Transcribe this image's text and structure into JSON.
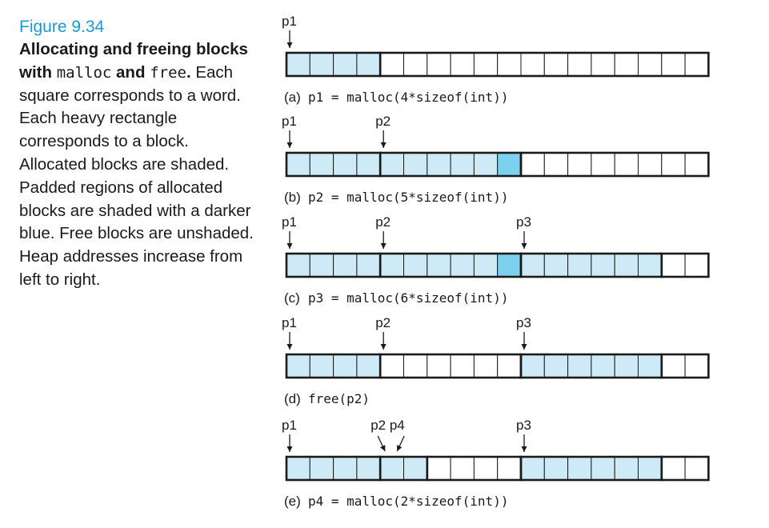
{
  "caption": {
    "figure_label": "Figure 9.34",
    "title_part1": "Allocating and freeing blocks with ",
    "title_code1": "malloc",
    "title_part2": "and ",
    "title_code2": "free",
    "title_part3": ".",
    "body": " Each square corresponds to a word. Each heavy rectangle corresponds to a block. Allocated blocks are shaded. Padded regions of allocated blocks are shaded with a darker blue. Free blocks are unshaded. Heap addresses increase from left to right."
  },
  "colors": {
    "allocated": "#cfeaf7",
    "padding": "#7ed0ef",
    "free": "#ffffff",
    "outline": "#1a1a1a",
    "figure_label": "#1c9ad6"
  },
  "word_count": 18,
  "rows": [
    {
      "label": "(a)",
      "code": "p1 = malloc(4*sizeof(int))",
      "pointers": [
        {
          "name": "p1",
          "word": 0
        }
      ],
      "blocks": [
        {
          "start": 0,
          "size": 4,
          "state": "allocated"
        },
        {
          "start": 4,
          "size": 14,
          "state": "free"
        }
      ]
    },
    {
      "label": "(b)",
      "code": "p2 = malloc(5*sizeof(int))",
      "pointers": [
        {
          "name": "p1",
          "word": 0
        },
        {
          "name": "p2",
          "word": 4
        }
      ],
      "blocks": [
        {
          "start": 0,
          "size": 4,
          "state": "allocated"
        },
        {
          "start": 4,
          "size": 6,
          "state": "allocated",
          "padding": [
            9
          ]
        },
        {
          "start": 10,
          "size": 8,
          "state": "free"
        }
      ]
    },
    {
      "label": "(c)",
      "code": "p3 = malloc(6*sizeof(int))",
      "pointers": [
        {
          "name": "p1",
          "word": 0
        },
        {
          "name": "p2",
          "word": 4
        },
        {
          "name": "p3",
          "word": 10
        }
      ],
      "blocks": [
        {
          "start": 0,
          "size": 4,
          "state": "allocated"
        },
        {
          "start": 4,
          "size": 6,
          "state": "allocated",
          "padding": [
            9
          ]
        },
        {
          "start": 10,
          "size": 6,
          "state": "allocated"
        },
        {
          "start": 16,
          "size": 2,
          "state": "free"
        }
      ]
    },
    {
      "label": "(d)",
      "code": "free(p2)",
      "pointers": [
        {
          "name": "p1",
          "word": 0
        },
        {
          "name": "p2",
          "word": 4
        },
        {
          "name": "p3",
          "word": 10
        }
      ],
      "blocks": [
        {
          "start": 0,
          "size": 4,
          "state": "allocated"
        },
        {
          "start": 4,
          "size": 6,
          "state": "free"
        },
        {
          "start": 10,
          "size": 6,
          "state": "allocated"
        },
        {
          "start": 16,
          "size": 2,
          "state": "free"
        }
      ]
    },
    {
      "label": "(e)",
      "code": "p4 = malloc(2*sizeof(int))",
      "pointers": [
        {
          "name": "p1",
          "word": 0
        },
        {
          "name": "p2 p4",
          "word": 4
        },
        {
          "name": "p3",
          "word": 10
        }
      ],
      "blocks": [
        {
          "start": 0,
          "size": 4,
          "state": "allocated"
        },
        {
          "start": 4,
          "size": 2,
          "state": "allocated"
        },
        {
          "start": 6,
          "size": 4,
          "state": "free"
        },
        {
          "start": 10,
          "size": 6,
          "state": "allocated"
        },
        {
          "start": 16,
          "size": 2,
          "state": "free"
        }
      ]
    }
  ]
}
